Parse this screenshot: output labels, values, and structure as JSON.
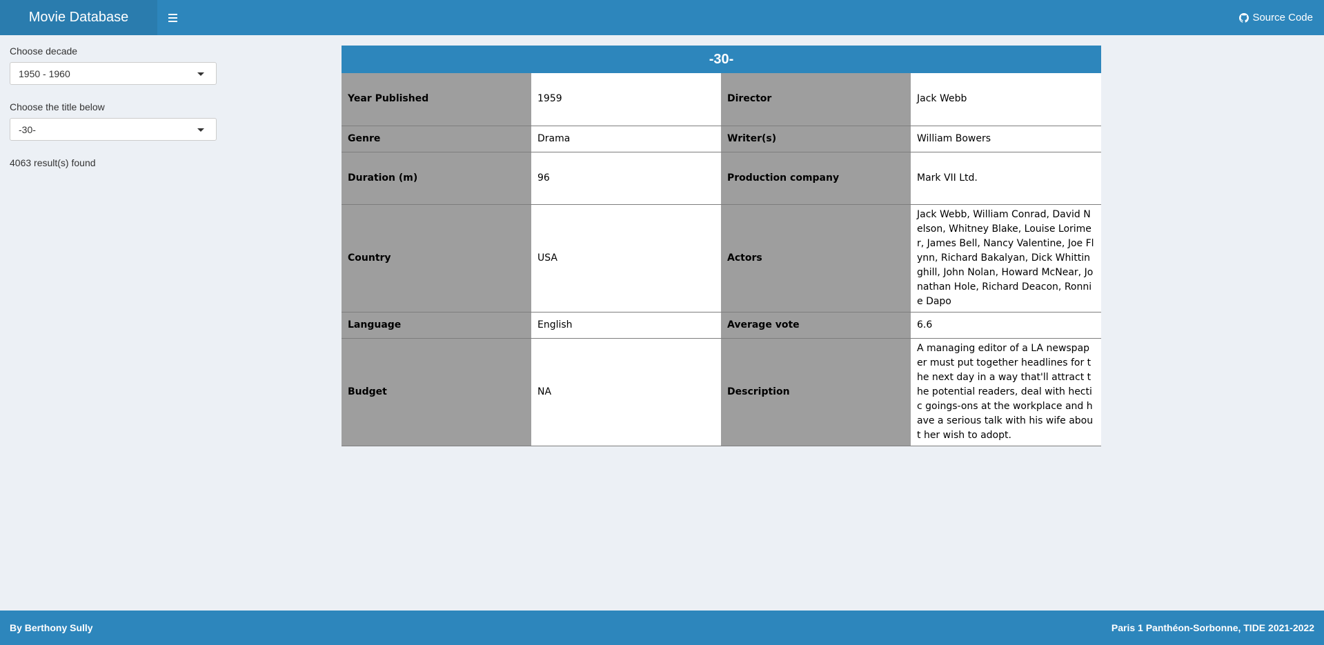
{
  "header": {
    "title": "Movie Database",
    "source_label": "Source Code"
  },
  "sidebar": {
    "decade_label": "Choose decade",
    "decade_value": "1950 - 1960",
    "title_label": "Choose the title below",
    "title_value": "-30-",
    "results": "4063 result(s) found"
  },
  "movie": {
    "title": "-30-",
    "rows": [
      {
        "k1": "Year Published",
        "v1": "1959",
        "k2": "Director",
        "v2": "Jack Webb"
      },
      {
        "k1": "Genre",
        "v1": "Drama",
        "k2": "Writer(s)",
        "v2": "William Bowers"
      },
      {
        "k1": "Duration (m)",
        "v1": "96",
        "k2": "Production company",
        "v2": "Mark VII Ltd."
      },
      {
        "k1": "Country",
        "v1": "USA",
        "k2": "Actors",
        "v2": "Jack Webb, William Conrad, David Nelson, Whitney Blake, Louise Lorimer, James Bell, Nancy Valentine, Joe Flynn, Richard Bakalyan, Dick Whittinghill, John Nolan, Howard McNear, Jonathan Hole, Richard Deacon, Ronnie Dapo"
      },
      {
        "k1": "Language",
        "v1": "English",
        "k2": "Average vote",
        "v2": "6.6"
      },
      {
        "k1": "Budget",
        "v1": "NA",
        "k2": "Description",
        "v2": "A managing editor of a LA newspaper must put together headlines for the next day in a way that'll attract the potential readers, deal with hectic goings-ons at the workplace and have a serious talk with his wife about her wish to adopt."
      }
    ]
  },
  "footer": {
    "left": "By Berthony Sully",
    "right": "Paris 1 Panthéon-Sorbonne, TIDE 2021-2022"
  },
  "colors": {
    "header": "#2d86bc",
    "logo": "#2a7cae",
    "key_cell": "#9e9e9e",
    "background": "#ecf0f5"
  }
}
